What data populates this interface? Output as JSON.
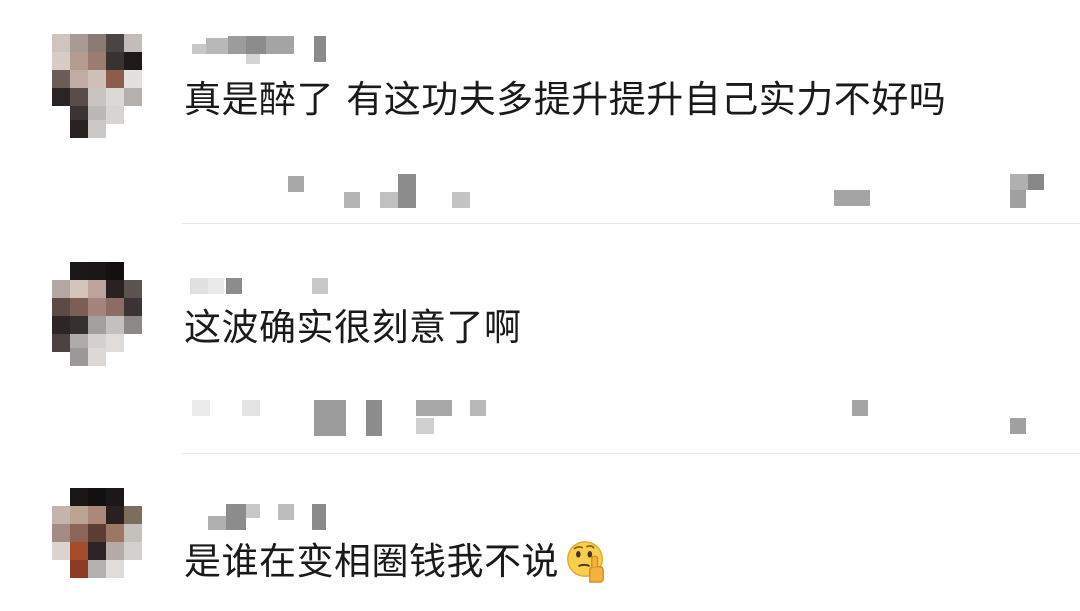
{
  "comments": [
    {
      "text": "真是醉了 有这功夫多提升提升自己实力不好吗",
      "emoji": ""
    },
    {
      "text": "这波确实很刻意了啊",
      "emoji": ""
    },
    {
      "text": "是谁在变相圈钱我不说",
      "emoji": "thinking-face-icon"
    }
  ],
  "colors": {
    "text": "#1a1a1a",
    "divider": "#e6e6e6",
    "emoji_face": "#f5c842"
  }
}
